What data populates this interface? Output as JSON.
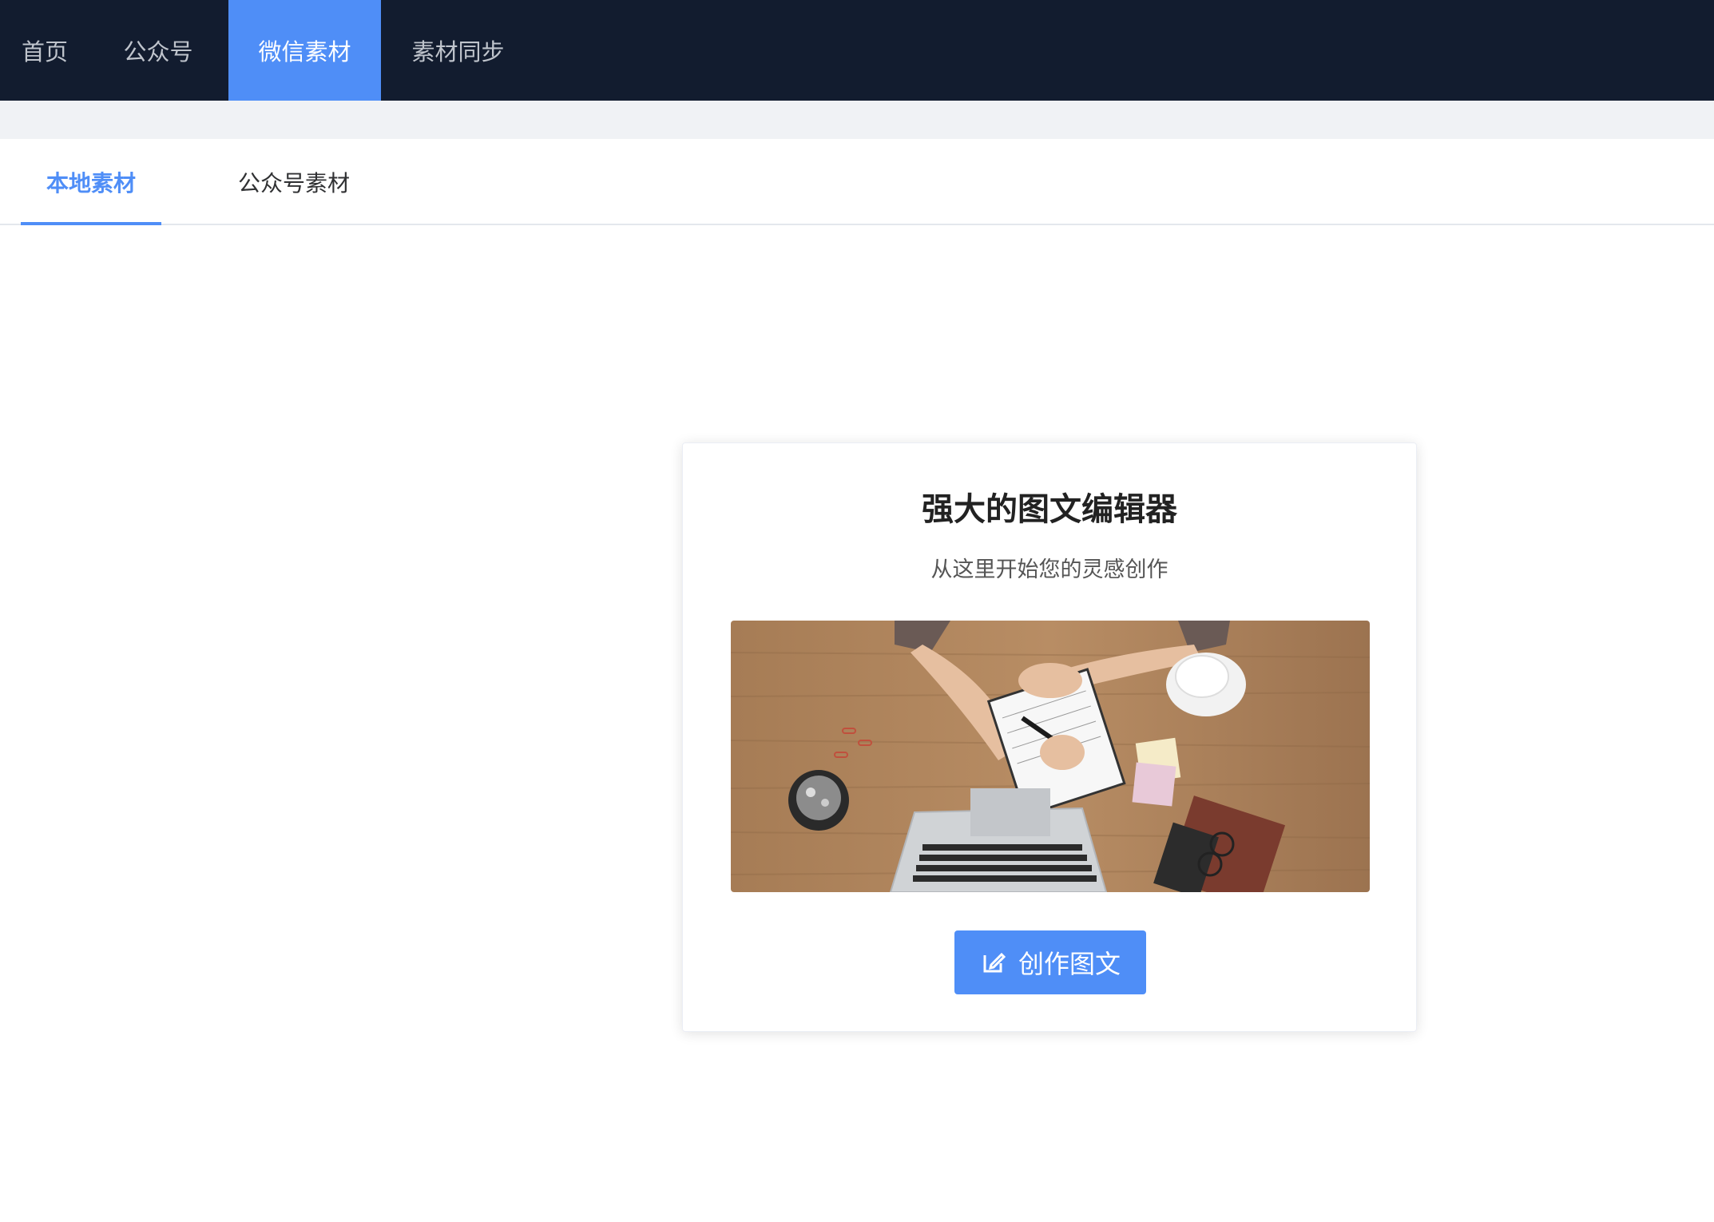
{
  "nav": {
    "items": [
      {
        "label": "首页"
      },
      {
        "label": "公众号"
      },
      {
        "label": "微信素材"
      },
      {
        "label": "素材同步"
      }
    ],
    "active_index": 2
  },
  "tabs": {
    "items": [
      {
        "label": "本地素材"
      },
      {
        "label": "公众号素材"
      }
    ],
    "active_index": 0
  },
  "card": {
    "title": "强大的图文编辑器",
    "subtitle": "从这里开始您的灵感创作",
    "image_icon": "workspace-desk-photo",
    "button_label": "创作图文",
    "button_icon": "edit-icon"
  },
  "colors": {
    "topbar": "#121c2f",
    "accent": "#4f8ef7",
    "strip": "#f0f2f5"
  }
}
